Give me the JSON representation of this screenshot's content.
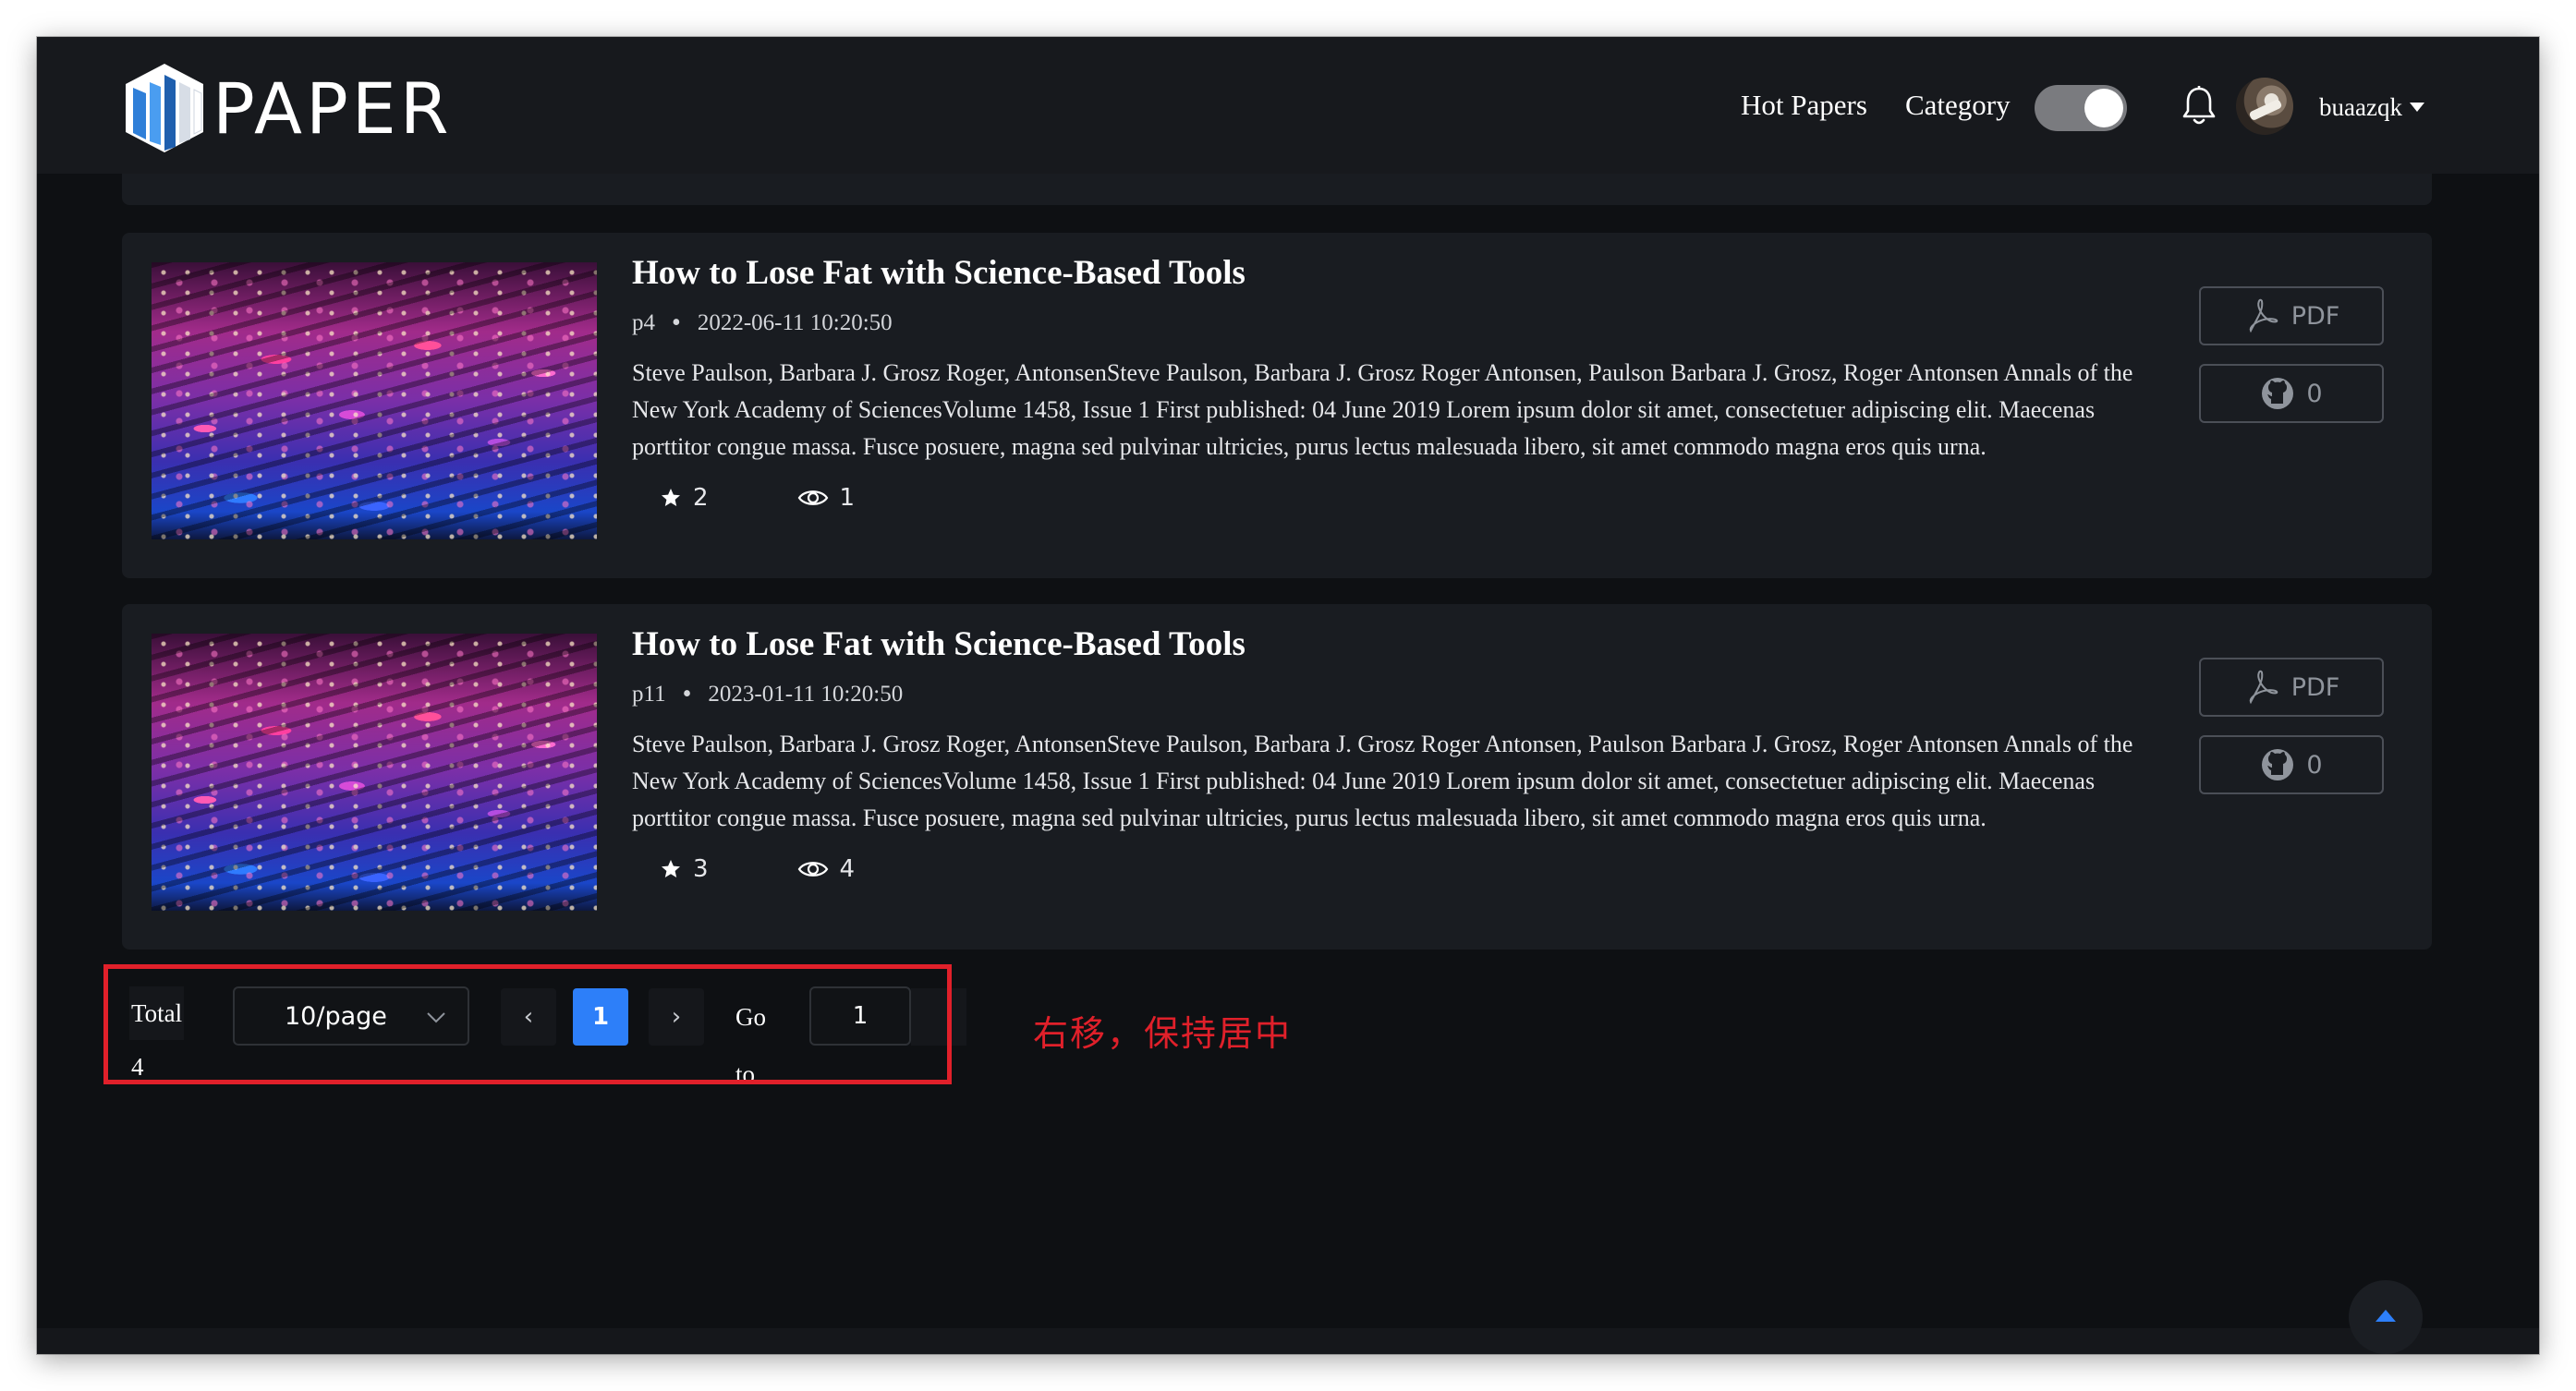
{
  "app": {
    "logo_text": "PAPER",
    "nav": {
      "hot_papers": "Hot Papers",
      "category": "Category"
    },
    "username": "buaazqk",
    "theme_toggle_on": true,
    "icons": {
      "notification": "bell-icon",
      "avatar": "user-avatar",
      "back_to_top": "arrow-up-icon"
    }
  },
  "papers": [
    {
      "title": "How to Lose Fat with Science-Based Tools",
      "page": "p4",
      "datetime": "2022-06-11 10:20:50",
      "abstract": "Steve Paulson, Barbara J. Grosz Roger, AntonsenSteve Paulson, Barbara J. Grosz Roger Antonsen, Paulson Barbara J. Grosz, Roger Antonsen Annals of the New York Academy of SciencesVolume 1458, Issue 1 First published: 04 June 2019 Lorem ipsum dolor sit amet, consectetuer adipiscing elit. Maecenas porttitor congue massa. Fusce posuere, magna sed pulvinar ultricies, purus lectus malesuada libero, sit amet commodo magna eros quis urna.",
      "stars": "2",
      "views": "1",
      "pdf_label": "PDF",
      "github_count": "0"
    },
    {
      "title": "How to Lose Fat with Science-Based Tools",
      "page": "p11",
      "datetime": "2023-01-11 10:20:50",
      "abstract": "Steve Paulson, Barbara J. Grosz Roger, AntonsenSteve Paulson, Barbara J. Grosz Roger Antonsen, Paulson Barbara J. Grosz, Roger Antonsen Annals of the New York Academy of SciencesVolume 1458, Issue 1 First published: 04 June 2019 Lorem ipsum dolor sit amet, consectetuer adipiscing elit. Maecenas porttitor congue massa. Fusce posuere, magna sed pulvinar ultricies, purus lectus malesuada libero, sit amet commodo magna eros quis urna.",
      "stars": "3",
      "views": "4",
      "pdf_label": "PDF",
      "github_count": "0"
    }
  ],
  "pagination": {
    "total": "Total 4",
    "page_size": "10/page",
    "prev": "‹",
    "current_page": "1",
    "next": "›",
    "goto_label": "Go to",
    "goto_value": "1"
  },
  "annotation": {
    "text": "右移，保持居中",
    "color": "#e0202a"
  },
  "colors": {
    "background": "#0e1013",
    "card": "#191c21",
    "accent": "#2d7ff9"
  }
}
